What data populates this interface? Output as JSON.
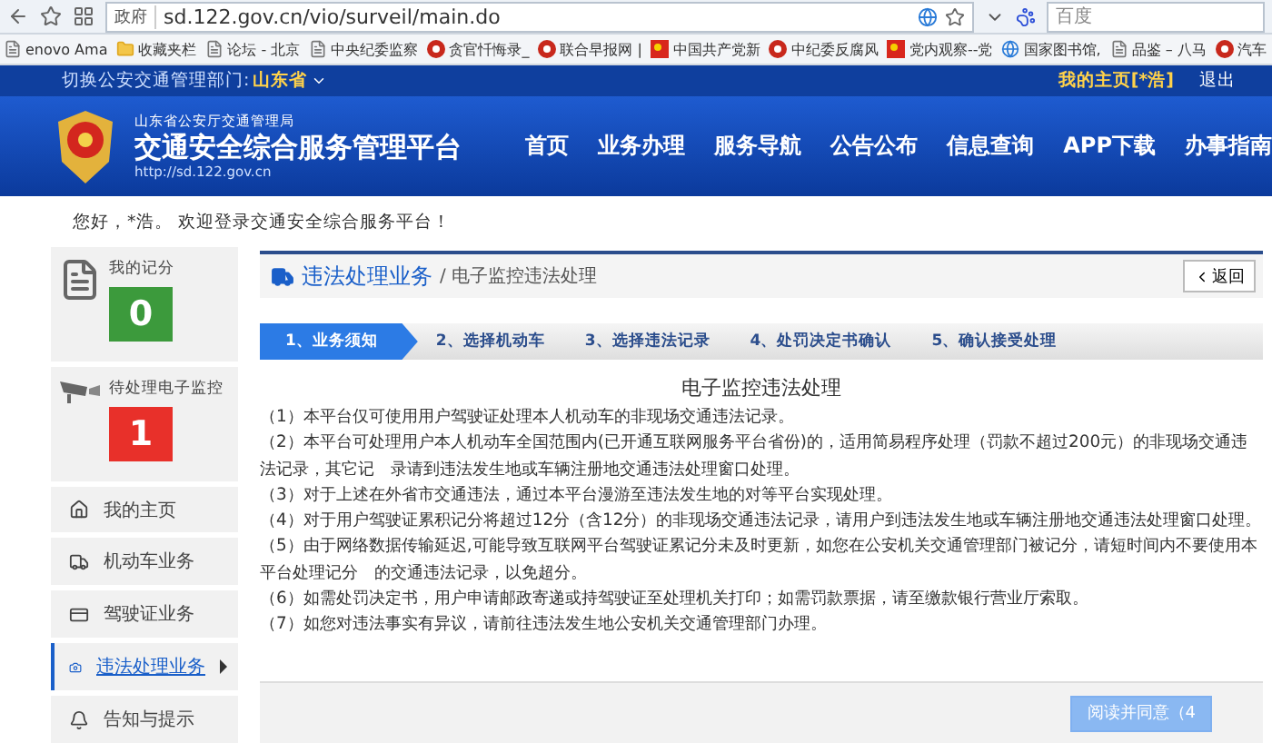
{
  "browser": {
    "site_badge": "政府",
    "url": "sd.122.gov.cn/vio/surveil/main.do",
    "search_placeholder": "百度"
  },
  "bookmarks": [
    {
      "label": "enovo Ama",
      "kind": "page"
    },
    {
      "label": "收藏夹栏",
      "kind": "folder"
    },
    {
      "label": "论坛 - 北京",
      "kind": "page"
    },
    {
      "label": "中央纪委监察",
      "kind": "page"
    },
    {
      "label": "贪官忏悔录_",
      "kind": "site"
    },
    {
      "label": "联合早报网 |",
      "kind": "site"
    },
    {
      "label": "中国共产党新",
      "kind": "party"
    },
    {
      "label": "中纪委反腐风",
      "kind": "site"
    },
    {
      "label": "党内观察--党",
      "kind": "party"
    },
    {
      "label": "国家图书馆,",
      "kind": "globe"
    },
    {
      "label": "品鉴 – 八马",
      "kind": "page"
    },
    {
      "label": "汽车",
      "kind": "site"
    }
  ],
  "top_bar": {
    "switch_label": "切换公安交通管理部门:",
    "region": "山东省",
    "user_link": "我的主页[*浩]",
    "logout": "退出"
  },
  "header": {
    "agency": "山东省公安厅交通管理局",
    "title": "交通安全综合服务管理平台",
    "url": "http://sd.122.gov.cn",
    "nav": [
      "首页",
      "业务办理",
      "服务导航",
      "公告公布",
      "信息查询",
      "APP下载",
      "办事指南"
    ]
  },
  "greeting": "您好，*浩。 欢迎登录交通安全综合服务平台！",
  "sidebar": {
    "stats": [
      {
        "label": "我的记分",
        "value": "0",
        "color": "#3c9a3c",
        "kind": "score"
      },
      {
        "label": "待处理电子监控",
        "value": "1",
        "color": "#e8302a",
        "kind": "camera"
      }
    ],
    "menu": [
      {
        "label": "我的主页",
        "kind": "home",
        "selected": false
      },
      {
        "label": "机动车业务",
        "kind": "truck",
        "selected": false
      },
      {
        "label": "驾驶证业务",
        "kind": "card",
        "selected": false
      },
      {
        "label": "违法处理业务",
        "kind": "camera",
        "selected": true
      },
      {
        "label": "告知与提示",
        "kind": "bell",
        "selected": false
      }
    ]
  },
  "breadcrumb": {
    "section": "违法处理业务",
    "page": "/ 电子监控违法处理",
    "back": "返回"
  },
  "steps": [
    {
      "label": "1、业务须知",
      "selected": true
    },
    {
      "label": "2、选择机动车",
      "selected": false
    },
    {
      "label": "3、选择违法记录",
      "selected": false
    },
    {
      "label": "4、处罚决定书确认",
      "selected": false
    },
    {
      "label": "5、确认接受处理",
      "selected": false
    }
  ],
  "notice": {
    "title": "电子监控违法处理",
    "items": [
      "（1）本平台仅可使用用户驾驶证处理本人机动车的非现场交通违法记录。",
      "（2）本平台可处理用户本人机动车全国范围内(已开通互联网服务平台省份)的，适用简易程序处理（罚款不超过200元）的非现场交通违法记录，其它记　录请到违法发生地或车辆注册地交通违法处理窗口处理。",
      "（3）对于上述在外省市交通违法，通过本平台漫游至违法发生地的对等平台实现处理。",
      "（4）对于用户驾驶证累积记分将超过12分（含12分）的非现场交通违法记录，请用户到违法发生地或车辆注册地交通违法处理窗口处理。",
      "（5）由于网络数据传输延迟,可能导致互联网平台驾驶证累记分未及时更新，如您在公安机关交通管理部门被记分，请短时间内不要使用本平台处理记分　的交通违法记录，以免超分。",
      "（6）如需处罚决定书，用户申请邮政寄递或持驾驶证至处理机关打印；如需罚款票据，请至缴款银行营业厅索取。",
      "（7）如您对违法事实有异议，请前往违法发生地公安机关交通管理部门办理。"
    ]
  },
  "agree_button": {
    "label": "阅读并同意（4",
    "disabled": true
  }
}
